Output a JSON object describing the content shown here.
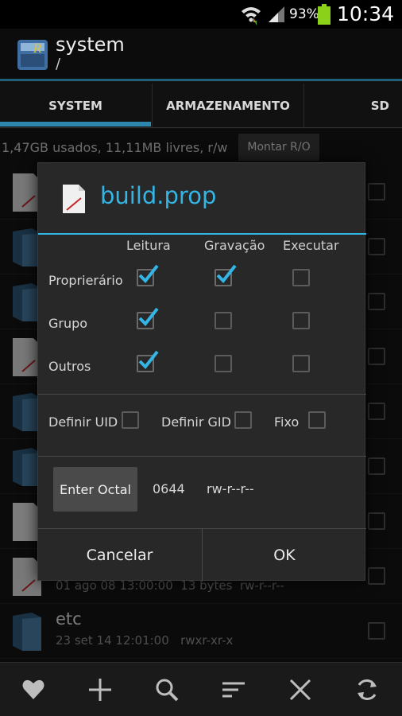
{
  "status_bar": {
    "battery_percent": "93%",
    "time": "10:34"
  },
  "header": {
    "title": "system",
    "path": "/"
  },
  "tabs": [
    {
      "label": "SYSTEM",
      "selected": true
    },
    {
      "label": "ARMAZENAMENTO",
      "selected": false
    },
    {
      "label": "SD",
      "selected": false
    }
  ],
  "info_bar": {
    "storage_text": "1,47GB usados, 11,11MB livres, r/w",
    "mount_label": "Montar R/O"
  },
  "file_list": [
    {
      "name": "",
      "meta": "",
      "kind": "file"
    },
    {
      "name": "",
      "meta": "",
      "kind": "folder"
    },
    {
      "name": "",
      "meta": "",
      "kind": "folder"
    },
    {
      "name": "",
      "meta": "",
      "kind": "file"
    },
    {
      "name": "",
      "meta": "",
      "kind": "folder"
    },
    {
      "name": "",
      "meta": "",
      "kind": "folder"
    },
    {
      "name": "",
      "meta": "",
      "kind": "blank"
    },
    {
      "name": "",
      "meta": "01 ago 08 13:00:00  13 bytes  rw-r--r--",
      "kind": "file"
    },
    {
      "name": "etc",
      "meta": "23 set 14 12:01:00   rwxr-xr-x",
      "kind": "folder"
    }
  ],
  "dialog": {
    "title": "build.prop",
    "columns": [
      "Leitura",
      "Gravação",
      "Executar"
    ],
    "rows": [
      {
        "label": "Proprierário",
        "read": true,
        "write": true,
        "exec": false
      },
      {
        "label": "Grupo",
        "read": true,
        "write": false,
        "exec": false
      },
      {
        "label": "Outros",
        "read": true,
        "write": false,
        "exec": false
      }
    ],
    "options": {
      "set_uid": "Definir UID",
      "set_uid_checked": false,
      "set_gid": "Definir GID",
      "set_gid_checked": false,
      "sticky": "Fixo",
      "sticky_checked": false
    },
    "octal_button": "Enter Octal",
    "octal_value": "0644",
    "perm_string": "rw-r--r--",
    "cancel_label": "Cancelar",
    "ok_label": "OK"
  },
  "bottom_bar": {
    "icons": [
      "heart-icon",
      "plus-icon",
      "search-icon",
      "sort-icon",
      "close-icon",
      "refresh-icon"
    ]
  },
  "colors": {
    "accent": "#33b5e5",
    "tab_indicator": "#2c86ad",
    "battery": "#8bd11a"
  }
}
